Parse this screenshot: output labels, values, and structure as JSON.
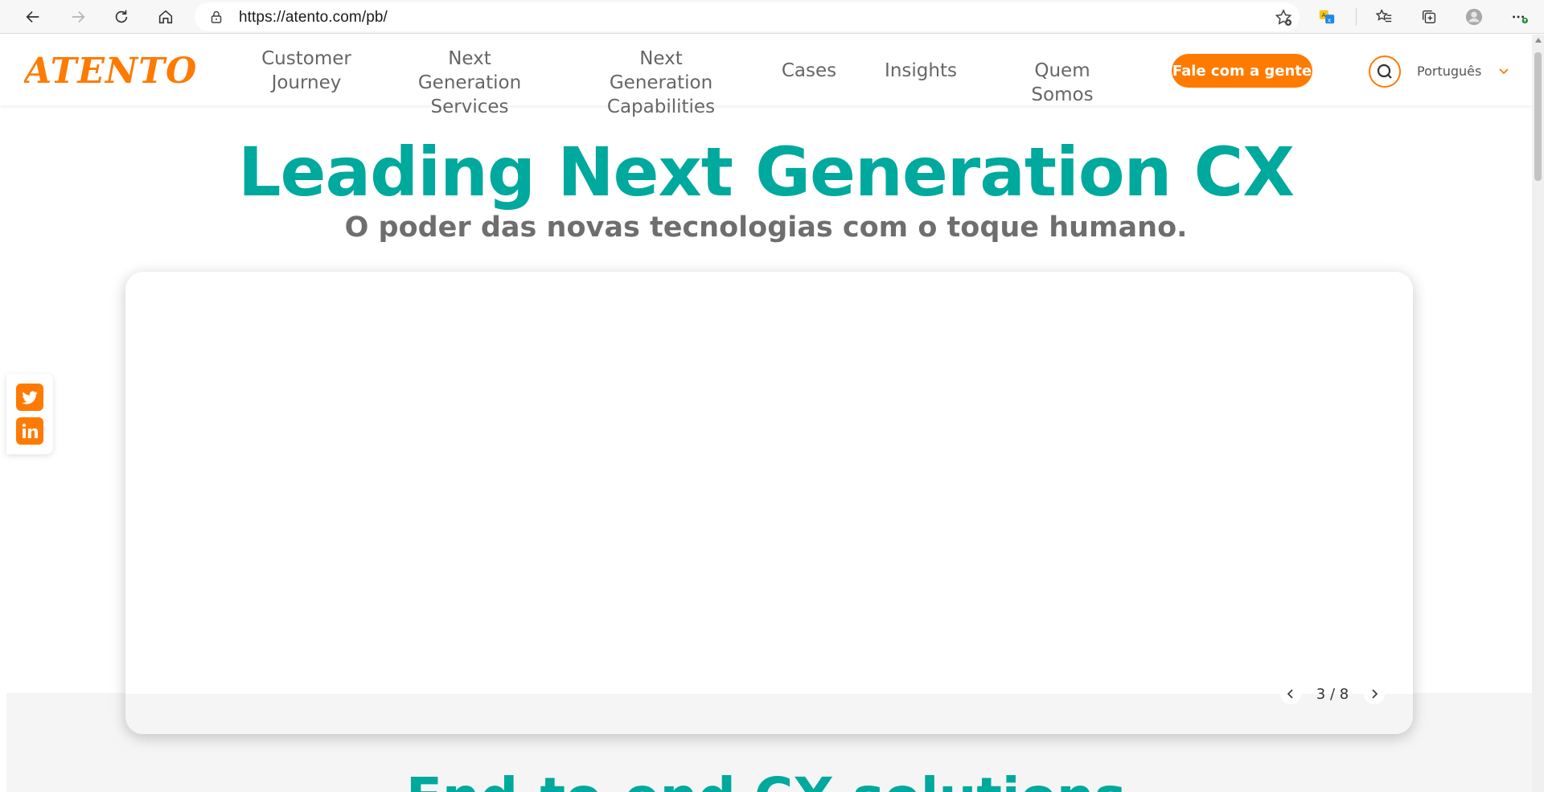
{
  "browser": {
    "url": "https://atento.com/pb/",
    "icons": [
      "back-icon",
      "forward-icon",
      "reload-icon",
      "home-icon",
      "lock-icon",
      "add-favorite-icon",
      "translate-icon",
      "favorites-icon",
      "collections-icon",
      "profile-icon",
      "more-icon"
    ]
  },
  "header": {
    "logo_text": "ATENTO",
    "nav": [
      {
        "line1": "Customer",
        "line2": "Journey"
      },
      {
        "line1": "Next Generation",
        "line2": "Services"
      },
      {
        "line1": "Next Generation",
        "line2": "Capabilities"
      },
      {
        "line1": "Cases"
      },
      {
        "line1": "Insights"
      },
      {
        "line1": "Quem Somos"
      }
    ],
    "cta_label": "Fale com a gente",
    "language": "Português"
  },
  "hero": {
    "title": "Leading Next Generation CX",
    "subtitle": "O poder das novas tecnologias com o toque humano."
  },
  "carousel": {
    "pager": "3 / 8"
  },
  "next_section": {
    "title": "End-to-end CX solutions"
  },
  "social": [
    "twitter-icon",
    "linkedin-icon"
  ],
  "colors": {
    "brand_orange": "#ff7a00",
    "brand_teal": "#00a99d",
    "nav_gray": "#666666"
  }
}
